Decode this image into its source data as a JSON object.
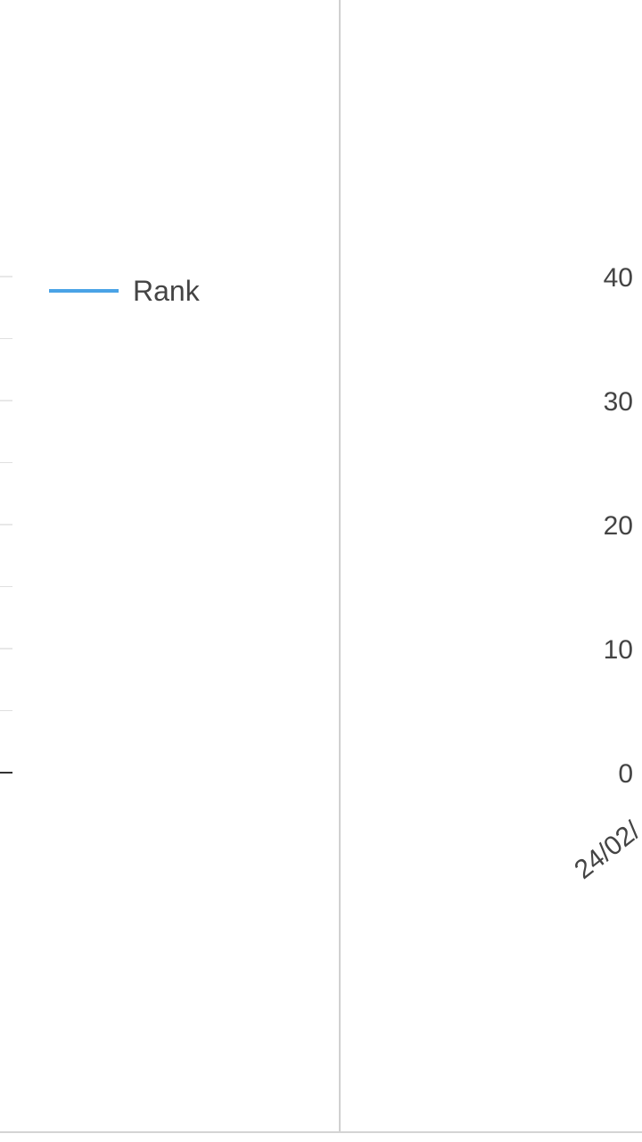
{
  "chart_data": [
    {
      "type": "line",
      "legend": [
        {
          "label": "Rank",
          "color": "#4aa3e6"
        }
      ],
      "legend_placement": "right",
      "grid": true
    },
    {
      "type": "line",
      "series": [
        {
          "name": "Rank",
          "values": [],
          "color": "#4aa3e6"
        }
      ],
      "x": [],
      "x_tick_labels": [
        "24/02/"
      ],
      "y_tick_labels": [
        "40",
        "30",
        "20",
        "10",
        "0"
      ],
      "ylim": [
        0,
        40
      ],
      "grid": true
    }
  ],
  "colors": {
    "series": "#4aa3e6",
    "tick_text": "#444444",
    "divider": "#d0d0d0",
    "gridline": "#e0e0e0",
    "baseline": "#333333"
  }
}
